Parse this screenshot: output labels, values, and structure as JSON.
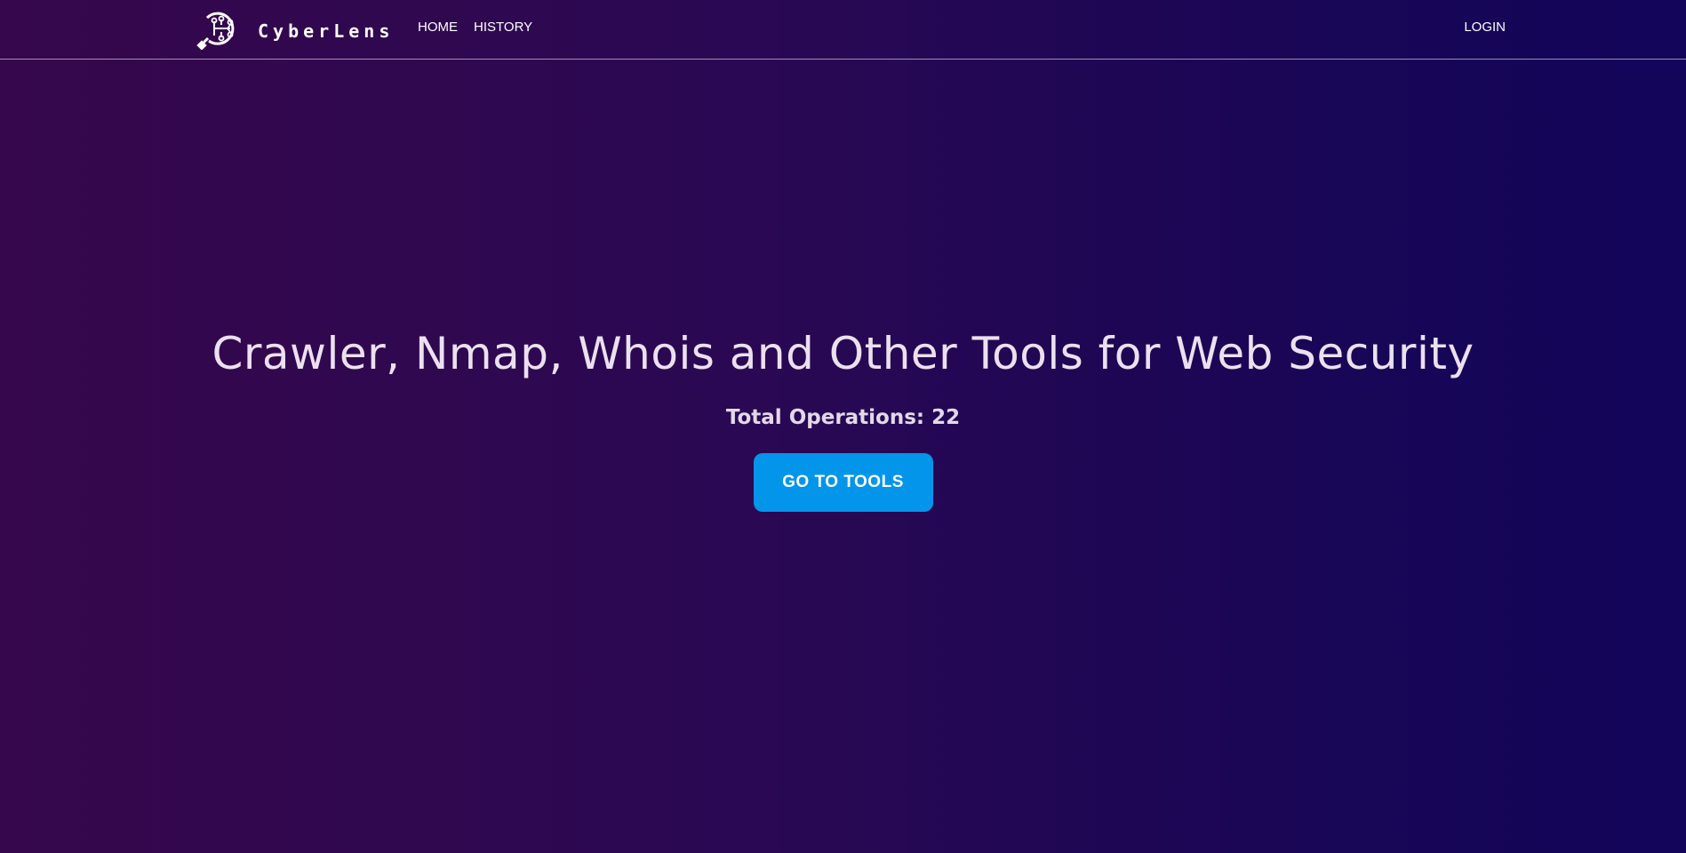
{
  "navbar": {
    "brand_name": "CyberLens",
    "brand_icon": "magnifier-circuit-icon",
    "links": [
      {
        "label": "HOME"
      },
      {
        "label": "HISTORY"
      }
    ],
    "login_label": "LOGIN"
  },
  "hero": {
    "title": "Crawler, Nmap, Whois and Other Tools for Web Security",
    "subtitle": "Total Operations: 22",
    "button_label": "GO TO TOOLS"
  },
  "colors": {
    "background_left": "#36074c",
    "background_right": "#12055a",
    "button": "#0395ea",
    "text": "#ece0ef"
  }
}
